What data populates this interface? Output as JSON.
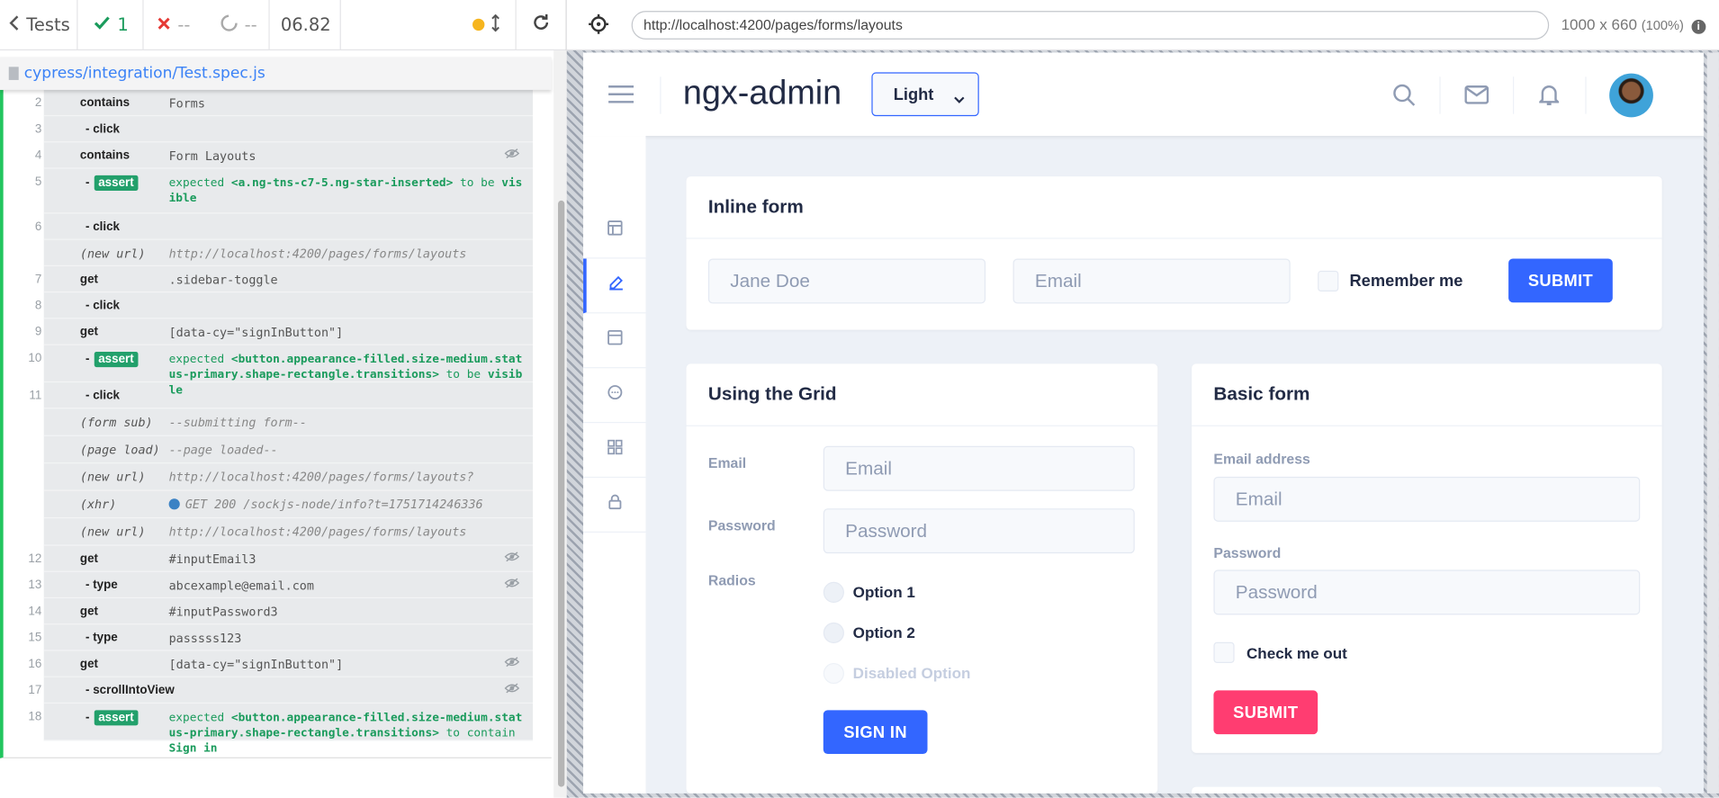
{
  "reporter": {
    "back_label": "Tests",
    "passed": "1",
    "failed": "--",
    "pending": "--",
    "duration": "06.82",
    "spec_file": "cypress/integration/Test.spec.js"
  },
  "commands": [
    {
      "num": "2",
      "name": "contains",
      "msg": "Forms",
      "type": "parent"
    },
    {
      "num": "3",
      "name": "- click",
      "msg": "",
      "type": "child"
    },
    {
      "num": "4",
      "name": "contains",
      "msg": "Form Layouts",
      "type": "parent",
      "hidden": true
    },
    {
      "num": "5",
      "name": "assert",
      "msg_pre": "expected ",
      "msg_el": "<a.ng-tns-c7-5.ng-star-inserted>",
      "msg_mid": " to be ",
      "msg_end": "visible",
      "type": "assert"
    },
    {
      "num": "6",
      "name": "- click",
      "msg": "",
      "type": "child"
    },
    {
      "num": "",
      "name": "(new url)",
      "msg": "http://localhost:4200/pages/forms/layouts",
      "type": "event"
    },
    {
      "num": "7",
      "name": "get",
      "msg": ".sidebar-toggle",
      "type": "parent"
    },
    {
      "num": "8",
      "name": "- click",
      "msg": "",
      "type": "child"
    },
    {
      "num": "9",
      "name": "get",
      "msg": "[data-cy=\"signInButton\"]",
      "type": "parent"
    },
    {
      "num": "10",
      "name": "assert",
      "msg_pre": "expected ",
      "msg_el": "<button.appearance-filled.size-medium.status-primary.shape-rectangle.transitions>",
      "msg_mid": " to be ",
      "msg_end": "visible",
      "type": "assert"
    },
    {
      "num": "11",
      "name": "- click",
      "msg": "",
      "type": "child"
    },
    {
      "num": "",
      "name": "(form sub)",
      "msg": "--submitting form--",
      "type": "event"
    },
    {
      "num": "",
      "name": "(page load)",
      "msg": "--page loaded--",
      "type": "event"
    },
    {
      "num": "",
      "name": "(new url)",
      "msg": "http://localhost:4200/pages/forms/layouts?",
      "type": "event"
    },
    {
      "num": "",
      "name": "(xhr)",
      "msg": "GET 200 /sockjs-node/info?t=1751714246336",
      "type": "xhr"
    },
    {
      "num": "",
      "name": "(new url)",
      "msg": "http://localhost:4200/pages/forms/layouts",
      "type": "event"
    },
    {
      "num": "12",
      "name": "get",
      "msg": "#inputEmail3",
      "type": "parent",
      "hidden": true
    },
    {
      "num": "13",
      "name": "- type",
      "msg": "abcexample@email.com",
      "type": "child",
      "hidden": true
    },
    {
      "num": "14",
      "name": "get",
      "msg": "#inputPassword3",
      "type": "parent"
    },
    {
      "num": "15",
      "name": "- type",
      "msg": "passsss123",
      "type": "child"
    },
    {
      "num": "16",
      "name": "get",
      "msg": "[data-cy=\"signInButton\"]",
      "type": "parent",
      "hidden": true
    },
    {
      "num": "17",
      "name": "- scrollIntoView",
      "msg": "",
      "type": "child",
      "hidden": true
    },
    {
      "num": "18",
      "name": "assert",
      "msg_pre": "expected ",
      "msg_el": "<button.appearance-filled.size-medium.status-primary.shape-rectangle.transitions>",
      "msg_mid": " to contain ",
      "msg_end": "Sign in",
      "type": "assert"
    }
  ],
  "aut": {
    "url": "http://localhost:4200/pages/forms/layouts",
    "viewport": "1000 x 660",
    "zoom": "(100%)"
  },
  "app": {
    "brand": "ngx-admin",
    "theme_select": "Light",
    "inline_form": {
      "title": "Inline form",
      "name_placeholder": "Jane Doe",
      "email_placeholder": "Email",
      "remember_label": "Remember me",
      "submit_label": "SUBMIT"
    },
    "grid_form": {
      "title": "Using the Grid",
      "email_label": "Email",
      "email_placeholder": "Email",
      "password_label": "Password",
      "password_placeholder": "Password",
      "radios_label": "Radios",
      "option1": "Option 1",
      "option2": "Option 2",
      "option3": "Disabled Option",
      "signin_label": "SIGN IN"
    },
    "basic_form": {
      "title": "Basic form",
      "email_label": "Email address",
      "email_placeholder": "Email",
      "password_label": "Password",
      "password_placeholder": "Password",
      "check_label": "Check me out",
      "submit_label": "SUBMIT"
    }
  },
  "colors": {
    "primary": "#3366ff",
    "danger": "#ff3d71",
    "passed": "#1a9b5c",
    "failed": "#e53935"
  }
}
